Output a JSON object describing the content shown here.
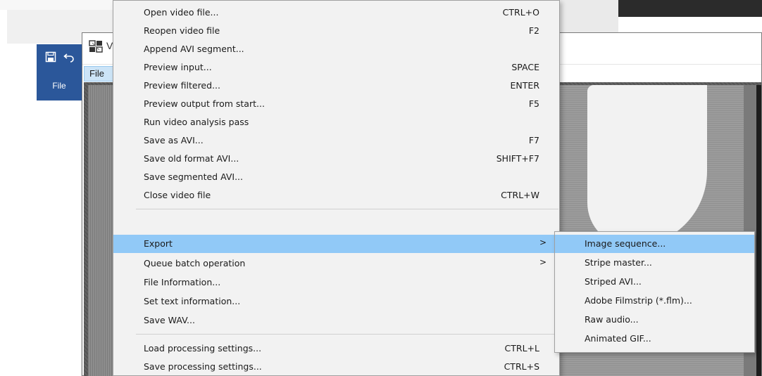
{
  "word": {
    "tab_label": "File",
    "save_icon": "save-icon",
    "undo_icon": "undo-icon",
    "ribbon_color": "#2b579a"
  },
  "vdub": {
    "title_truncated": "V",
    "menubar_file": "File",
    "menu_active_color": "#91c9f7"
  },
  "file_menu": {
    "items": [
      {
        "label": "Open video file...",
        "shortcut": "CTRL+O"
      },
      {
        "label": "Reopen video file",
        "shortcut": "F2"
      },
      {
        "label": "Append AVI segment...",
        "shortcut": ""
      },
      {
        "label": "Preview input...",
        "shortcut": "SPACE"
      },
      {
        "label": "Preview filtered...",
        "shortcut": "ENTER"
      },
      {
        "label": "Preview output from start...",
        "shortcut": "F5"
      },
      {
        "label": "Run video analysis pass",
        "shortcut": ""
      },
      {
        "label": "Save as AVI...",
        "shortcut": "F7"
      },
      {
        "label": "Save old format AVI...",
        "shortcut": "SHIFT+F7"
      },
      {
        "label": "Save segmented AVI...",
        "shortcut": ""
      },
      {
        "label": "Close video file",
        "shortcut": "CTRL+W"
      },
      {
        "label": "Export",
        "shortcut": "",
        "submenu": true,
        "active": true
      },
      {
        "label": "Queue batch operation",
        "shortcut": "",
        "submenu": true
      },
      {
        "label": "File Information...",
        "shortcut": ""
      },
      {
        "label": "Set text information...",
        "shortcut": ""
      },
      {
        "label": "Save WAV...",
        "shortcut": ""
      },
      {
        "label": "Load processing settings...",
        "shortcut": "CTRL+L"
      },
      {
        "label": "Save processing settings...",
        "shortcut": "CTRL+S"
      }
    ],
    "submenu_arrow": ">"
  },
  "export_submenu": {
    "items": [
      {
        "label": "Image sequence...",
        "active": true
      },
      {
        "label": "Stripe master..."
      },
      {
        "label": "Striped AVI..."
      },
      {
        "label": "Adobe Filmstrip (*.flm)..."
      },
      {
        "label": "Raw audio..."
      },
      {
        "label": "Animated GIF..."
      }
    ]
  }
}
